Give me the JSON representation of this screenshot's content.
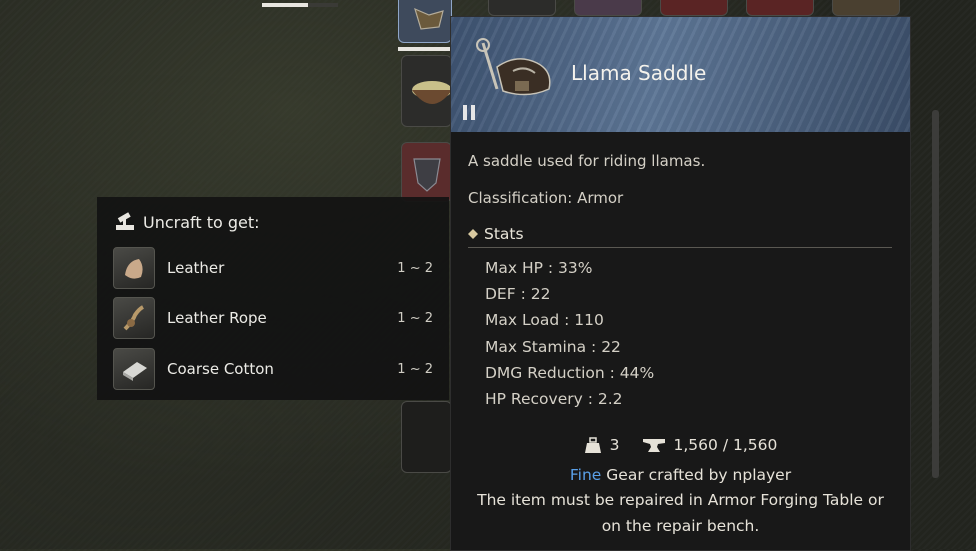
{
  "uncraft": {
    "title": "Uncraft to get:",
    "items": [
      {
        "name": "Leather",
        "qty": "1 ~ 2",
        "icon": "leather-icon"
      },
      {
        "name": "Leather Rope",
        "qty": "1 ~ 2",
        "icon": "leather-rope-icon"
      },
      {
        "name": "Coarse Cotton",
        "qty": "1 ~ 2",
        "icon": "coarse-cotton-icon"
      }
    ]
  },
  "tooltip": {
    "name": "Llama Saddle",
    "description": "A saddle used for riding llamas.",
    "classification": "Classification: Armor",
    "stats_heading": "Stats",
    "stats": [
      "Max HP : 33%",
      "DEF : 22",
      "Max Load : 110",
      "Max Stamina : 22",
      "DMG Reduction : 44%",
      "HP Recovery : 2.2"
    ],
    "weight": "3",
    "durability": "1,560 / 1,560",
    "quality": "Fine",
    "crafted_by": "Gear crafted by nplayer",
    "repair_note_1": "The item must be repaired in Armor Forging Table or",
    "repair_note_2": "on the repair bench."
  },
  "colors": {
    "header_blue": "#5d7696",
    "quality_fine": "#5aa0e8",
    "panel_bg": "#181818"
  },
  "top_progress": 0.6
}
